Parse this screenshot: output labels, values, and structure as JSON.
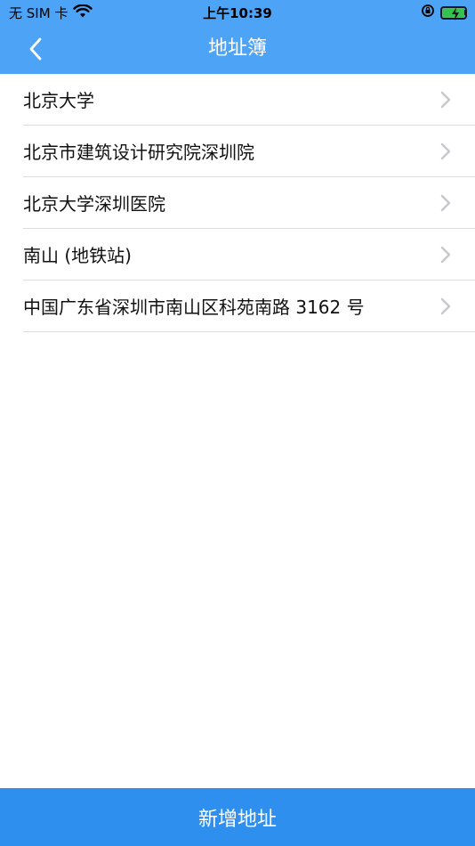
{
  "status_bar": {
    "carrier": "无 SIM 卡",
    "time": "上午10:39",
    "icons": [
      "wifi-icon",
      "rotation-lock-icon",
      "battery-charging-icon"
    ]
  },
  "header": {
    "title": "地址簿",
    "back_icon": "chevron-left-icon"
  },
  "addresses": [
    {
      "label": "北京大学"
    },
    {
      "label": "北京市建筑设计研究院深圳院"
    },
    {
      "label": "北京大学深圳医院"
    },
    {
      "label": "南山 (地铁站)"
    },
    {
      "label": "中国广东省深圳市南山区科苑南路 3162 号"
    }
  ],
  "footer": {
    "add_label": "新增地址"
  },
  "colors": {
    "header_bg": "#4da3f5",
    "button_bg": "#2f8fee",
    "divider": "#dcdcdc",
    "chevron": "#c7c7cc"
  }
}
